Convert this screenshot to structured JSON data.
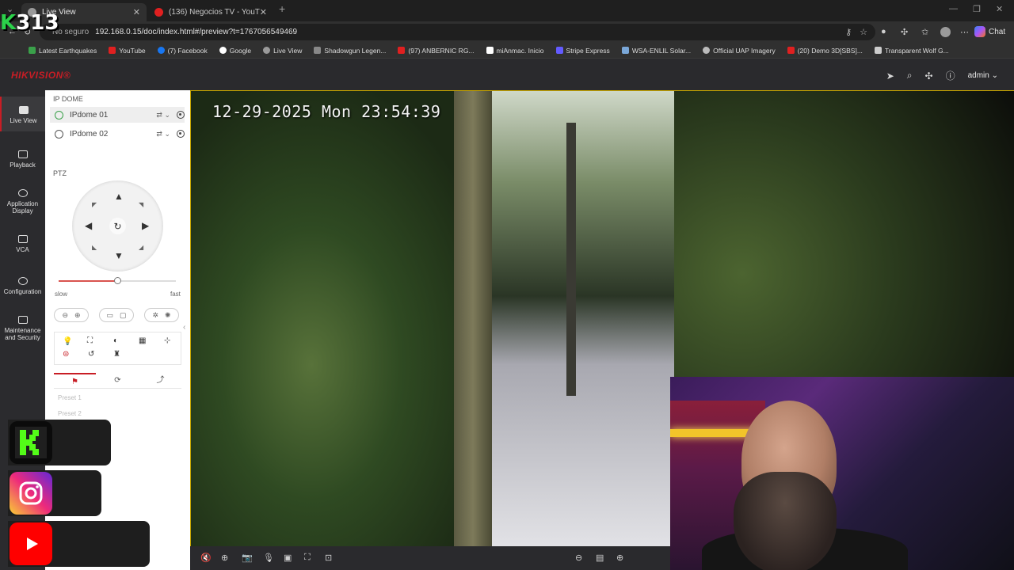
{
  "browser": {
    "tabs": [
      {
        "title": "Live View",
        "active": true,
        "color": "#9a9a9a"
      },
      {
        "title": "(136) Negocios TV - YouTube",
        "active": false,
        "color": "#e02020"
      }
    ],
    "new_tab_label": "+",
    "url_secure": "No seguro",
    "url": "192.168.0.15/doc/index.html#/preview?t=1767056549469",
    "chat_label": "Chat",
    "bookmarks": [
      {
        "label": "Latest Earthquakes",
        "color": "#3aa14a"
      },
      {
        "label": "YouTube",
        "color": "#e02020"
      },
      {
        "label": "(7) Facebook",
        "color": "#1877f2"
      },
      {
        "label": "Google",
        "color": "#ffffff"
      },
      {
        "label": "Live View",
        "color": "#9a9a9a"
      },
      {
        "label": "Shadowgun Legen...",
        "color": "#888888"
      },
      {
        "label": "(97) ANBERNIC RG...",
        "color": "#e02020"
      },
      {
        "label": "miAnmac. Inicio",
        "color": "#ffffff"
      },
      {
        "label": "Stripe Express",
        "color": "#635bff"
      },
      {
        "label": "WSA-ENLIL Solar...",
        "color": "#7aa7d8"
      },
      {
        "label": "Official UAP Imagery",
        "color": "#bbbbbb"
      },
      {
        "label": "(20) Demo 3D[SBS]...",
        "color": "#e02020"
      },
      {
        "label": "Transparent Wolf G...",
        "color": "#cccccc"
      }
    ]
  },
  "app": {
    "logo_red": "HIK",
    "logo_white": "VISION®",
    "user": "admin",
    "nav": [
      {
        "label": "Live View",
        "active": true
      },
      {
        "label": "Playback",
        "active": false
      },
      {
        "label": "Application Display",
        "active": false
      },
      {
        "label": "VCA",
        "active": false
      },
      {
        "label": "Configuration",
        "active": false
      },
      {
        "label": "Maintenance and Security",
        "active": false
      }
    ],
    "panel": {
      "group_title": "IP DOME",
      "cameras": [
        {
          "name": "IPdome 01",
          "selected": true
        },
        {
          "name": "IPdome 02",
          "selected": false
        }
      ],
      "ptz_title": "PTZ",
      "speed_slow": "slow",
      "speed_fast": "fast",
      "speed_fraction": 0.5,
      "presets": [
        "Preset 1",
        "Preset 2"
      ]
    },
    "osd_timestamp": "12-29-2025 Mon 23:54:39"
  },
  "overlay": {
    "channel_tag": "K313",
    "channel_k": "K",
    "channel_num": "313"
  }
}
